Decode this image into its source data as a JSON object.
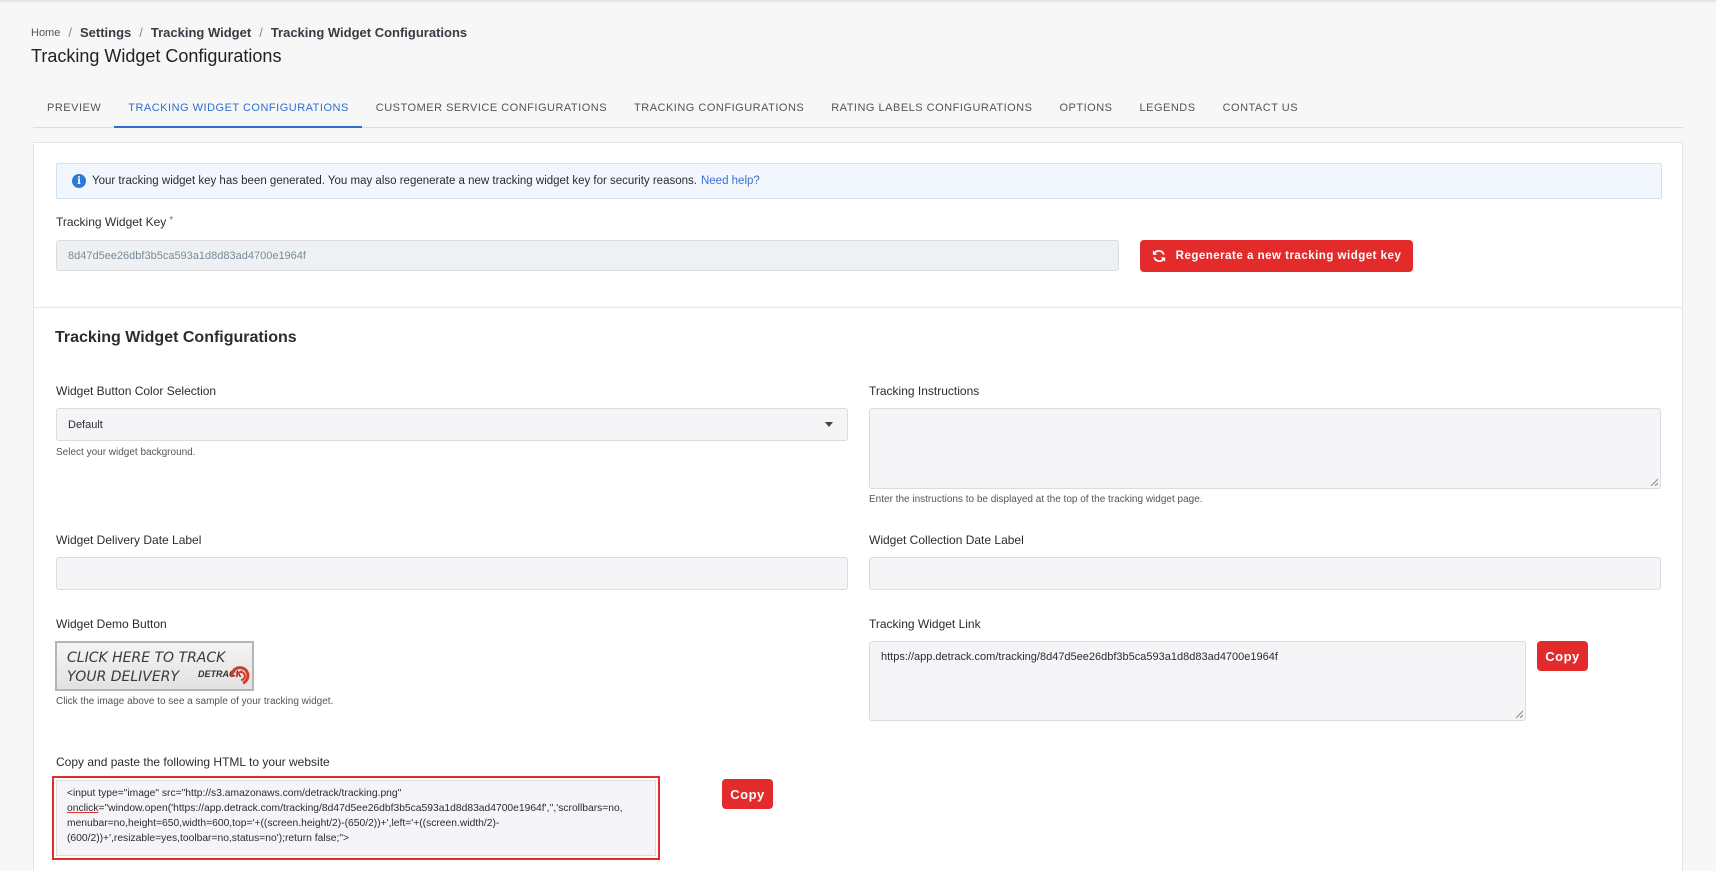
{
  "breadcrumb": {
    "home": "Home",
    "items": [
      "Settings",
      "Tracking Widget",
      "Tracking Widget Configurations"
    ]
  },
  "page_title": "Tracking Widget Configurations",
  "tabs": [
    {
      "label": "PREVIEW",
      "active": false
    },
    {
      "label": "TRACKING WIDGET CONFIGURATIONS",
      "active": true
    },
    {
      "label": "CUSTOMER SERVICE CONFIGURATIONS",
      "active": false
    },
    {
      "label": "TRACKING CONFIGURATIONS",
      "active": false
    },
    {
      "label": "RATING LABELS CONFIGURATIONS",
      "active": false
    },
    {
      "label": "OPTIONS",
      "active": false
    },
    {
      "label": "LEGENDS",
      "active": false
    },
    {
      "label": "CONTACT US",
      "active": false
    }
  ],
  "info": {
    "message": "Your tracking widget key has been generated. You may also regenerate a new tracking widget key for security reasons.",
    "link": "Need help?"
  },
  "key": {
    "label": "Tracking Widget Key",
    "required_mark": "*",
    "value": "8d47d5ee26dbf3b5ca593a1d8d83ad4700e1964f",
    "regenerate_label": "Regenerate a new tracking widget key"
  },
  "section_title": "Tracking Widget Configurations",
  "color_selection": {
    "label": "Widget Button Color Selection",
    "value": "Default",
    "help": "Select your widget background."
  },
  "instructions": {
    "label": "Tracking Instructions",
    "value": "",
    "help": "Enter the instructions to be displayed at the top of the tracking widget page."
  },
  "delivery_date": {
    "label": "Widget Delivery Date Label",
    "value": ""
  },
  "collection_date": {
    "label": "Widget Collection Date Label",
    "value": ""
  },
  "demo_button": {
    "label": "Widget Demo Button",
    "line1": "CLICK HERE TO TRACK",
    "line2": "YOUR DELIVERY",
    "logo": "DETRACK",
    "help": "Click the image above to see a sample of your tracking widget."
  },
  "widget_link": {
    "label": "Tracking Widget Link",
    "value": "https://app.detrack.com/tracking/8d47d5ee26dbf3b5ca593a1d8d83ad4700e1964f",
    "copy_label": "Copy"
  },
  "html_snippet": {
    "label": "Copy and paste the following HTML to your website",
    "part1": "<input type=\"image\" src=\"http://s3.amazonaws.com/detrack/tracking.png\"\n",
    "underlined": "onclick",
    "part2": "=\"window.open('https://app.detrack.com/tracking/8d47d5ee26dbf3b5ca593a1d8d83ad4700e1964f','','scrollbars=no,\nmenubar=no,height=650,width=600,top='+((screen.height/2)-(650/2))+',left='+((screen.width/2)-\n(600/2))+',resizable=yes,toolbar=no,status=no');return false;\">",
    "copy_label": "Copy"
  },
  "colors": {
    "accent": "#2f6fd0",
    "danger": "#e32b2b"
  }
}
